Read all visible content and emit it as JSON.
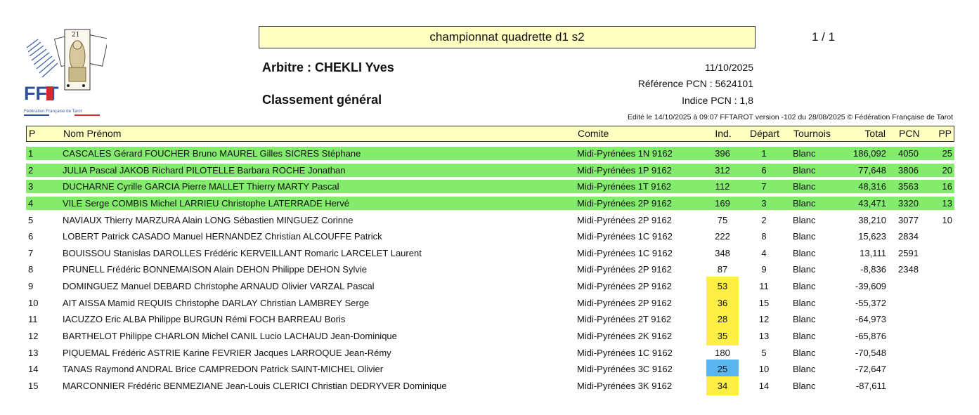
{
  "header": {
    "title": "championnat quadrette d1 s2",
    "page": "1 / 1",
    "arbitre": "Arbitre : CHEKLI Yves",
    "classement": "Classement général",
    "date": "11/10/2025",
    "reference": "Référence PCN : 5624101",
    "indice": "Indice PCN : 1,8",
    "edited": "Edité le 14/10/2025 à 09:07 FFTAROT version -102 du 28/08/2025 © Fédération Française de Tarot"
  },
  "logo": {
    "letters": "FFT",
    "caption": "Fédération Française de Tarot"
  },
  "colors": {
    "header_bg": "#ffffc2",
    "highlight_row": "#84ec6c",
    "ind_yellow": "#ffee44",
    "ind_blue": "#5ab4f0"
  },
  "columns": {
    "p": "P",
    "nom": "Nom Prénom",
    "comite": "Comite",
    "ind": "Ind.",
    "depart": "Départ",
    "tournois": "Tournois",
    "total": "Total",
    "pcn": "PCN",
    "pp": "PP"
  },
  "rows": [
    {
      "p": "1",
      "nom": "CASCALES Gérard FOUCHER Bruno MAUREL Gilles SICRES Stéphane",
      "comite": "Midi-Pyrénées 1N 9162",
      "ind": "396",
      "depart": "1",
      "tournois": "Blanc",
      "total": "186,092",
      "pcn": "4050",
      "pp": "25",
      "highlight": true,
      "ind_mark": ""
    },
    {
      "p": "2",
      "nom": "JULIA Pascal JAKOB Richard PILOTELLE Barbara ROCHE Jonathan",
      "comite": "Midi-Pyrénées 1P 9162",
      "ind": "312",
      "depart": "6",
      "tournois": "Blanc",
      "total": "77,648",
      "pcn": "3806",
      "pp": "20",
      "highlight": true,
      "ind_mark": ""
    },
    {
      "p": "3",
      "nom": "DUCHARNE Cyrille GARCIA Pierre MALLET Thierry MARTY Pascal",
      "comite": "Midi-Pyrénées 1T 9162",
      "ind": "112",
      "depart": "7",
      "tournois": "Blanc",
      "total": "48,316",
      "pcn": "3563",
      "pp": "16",
      "highlight": true,
      "ind_mark": ""
    },
    {
      "p": "4",
      "nom": "VILE Serge COMBIS Michel LARRIEU Christophe LATERRADE Hervé",
      "comite": "Midi-Pyrénées 2P 9162",
      "ind": "169",
      "depart": "3",
      "tournois": "Blanc",
      "total": "43,471",
      "pcn": "3320",
      "pp": "13",
      "highlight": true,
      "ind_mark": ""
    },
    {
      "p": "5",
      "nom": "NAVIAUX Thierry MARZURA Alain LONG Sébastien MINGUEZ Corinne",
      "comite": "Midi-Pyrénées 2P 9162",
      "ind": "75",
      "depart": "2",
      "tournois": "Blanc",
      "total": "38,210",
      "pcn": "3077",
      "pp": "10",
      "highlight": false,
      "ind_mark": ""
    },
    {
      "p": "6",
      "nom": "LOBERT Patrick CASADO Manuel HERNANDEZ Christian ALCOUFFE Patrick",
      "comite": "Midi-Pyrénées 1C 9162",
      "ind": "222",
      "depart": "8",
      "tournois": "Blanc",
      "total": "15,623",
      "pcn": "2834",
      "pp": "",
      "highlight": false,
      "ind_mark": ""
    },
    {
      "p": "7",
      "nom": "BOUISSOU Stanislas DAROLLES Frédéric KERVEILLANT Romaric LARCELET Laurent",
      "comite": "Midi-Pyrénées 1C 9162",
      "ind": "348",
      "depart": "4",
      "tournois": "Blanc",
      "total": "13,111",
      "pcn": "2591",
      "pp": "",
      "highlight": false,
      "ind_mark": ""
    },
    {
      "p": "8",
      "nom": "PRUNELL Frédéric BONNEMAISON Alain DEHON Philippe DEHON Sylvie",
      "comite": "Midi-Pyrénées 2P 9162",
      "ind": "87",
      "depart": "9",
      "tournois": "Blanc",
      "total": "-8,836",
      "pcn": "2348",
      "pp": "",
      "highlight": false,
      "ind_mark": ""
    },
    {
      "p": "9",
      "nom": "DOMINGUEZ Manuel DEBARD Christophe ARNAUD Olivier VARZAL Pascal",
      "comite": "Midi-Pyrénées 2P 9162",
      "ind": "53",
      "depart": "11",
      "tournois": "Blanc",
      "total": "-39,609",
      "pcn": "",
      "pp": "",
      "highlight": false,
      "ind_mark": "yellow"
    },
    {
      "p": "10",
      "nom": "AIT AISSA Mamid REQUIS Christophe DARLAY Christian LAMBREY Serge",
      "comite": "Midi-Pyrénées 2P 9162",
      "ind": "36",
      "depart": "15",
      "tournois": "Blanc",
      "total": "-55,372",
      "pcn": "",
      "pp": "",
      "highlight": false,
      "ind_mark": "yellow"
    },
    {
      "p": "11",
      "nom": "IACUZZO Eric ALBA Philippe BURGUN Rémi FOCH BARREAU Boris",
      "comite": "Midi-Pyrénées 2T 9162",
      "ind": "28",
      "depart": "12",
      "tournois": "Blanc",
      "total": "-64,973",
      "pcn": "",
      "pp": "",
      "highlight": false,
      "ind_mark": "yellow"
    },
    {
      "p": "12",
      "nom": "BARTHELOT Philippe CHARLON Michel CANIL Lucio LACHAUD Jean-Dominique",
      "comite": "Midi-Pyrénées 2K 9162",
      "ind": "35",
      "depart": "13",
      "tournois": "Blanc",
      "total": "-65,876",
      "pcn": "",
      "pp": "",
      "highlight": false,
      "ind_mark": "yellow"
    },
    {
      "p": "13",
      "nom": "PIQUEMAL Frédéric ASTRIE Karine FEVRIER Jacques LARROQUE Jean-Rémy",
      "comite": "Midi-Pyrénées 1C 9162",
      "ind": "180",
      "depart": "5",
      "tournois": "Blanc",
      "total": "-70,548",
      "pcn": "",
      "pp": "",
      "highlight": false,
      "ind_mark": ""
    },
    {
      "p": "14",
      "nom": "TANAS Raymond ANDRAL Brice CAMPREDON Patrick SAINT-MICHEL Olivier",
      "comite": "Midi-Pyrénées 3C 9162",
      "ind": "25",
      "depart": "10",
      "tournois": "Blanc",
      "total": "-72,647",
      "pcn": "",
      "pp": "",
      "highlight": false,
      "ind_mark": "blue"
    },
    {
      "p": "15",
      "nom": "MARCONNIER Frédéric BENMEZIANE Jean-Louis CLERICI Christian DEDRYVER Dominique",
      "comite": "Midi-Pyrénées 3K 9162",
      "ind": "34",
      "depart": "14",
      "tournois": "Blanc",
      "total": "-87,611",
      "pcn": "",
      "pp": "",
      "highlight": false,
      "ind_mark": "yellow"
    }
  ]
}
